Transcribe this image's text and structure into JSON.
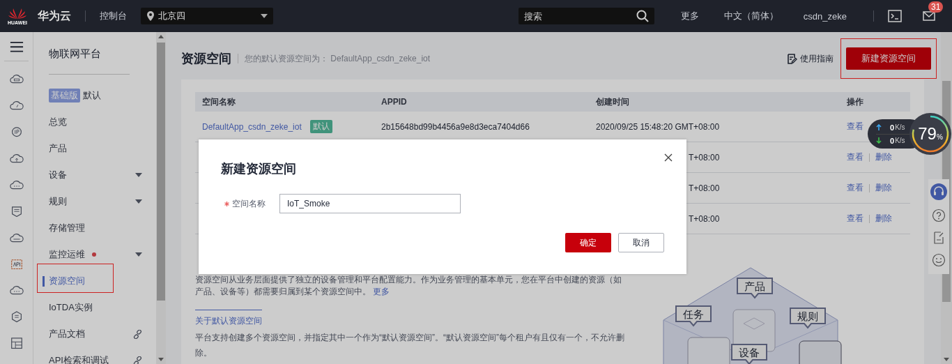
{
  "top_bar": {
    "logo_text": "HUAWEI",
    "brand": "华为云",
    "console": "控制台",
    "region": "北京四",
    "search": {
      "placeholder": "搜索"
    },
    "links": [
      "更多",
      "中文（简体）",
      "csdn_zeke"
    ],
    "mail_badge": "31"
  },
  "sidebar": {
    "title": "物联网平台",
    "items": [
      {
        "kind": "tag",
        "tag": "基础版",
        "label": "默认",
        "selected": false,
        "alert": false,
        "highlighted": false
      },
      {
        "kind": "plain",
        "label": "总览",
        "selected": false,
        "alert": false,
        "highlighted": false
      },
      {
        "kind": "plain",
        "label": "产品",
        "selected": false,
        "alert": false,
        "highlighted": false
      },
      {
        "kind": "expand",
        "label": "设备",
        "selected": false,
        "alert": false,
        "highlighted": false
      },
      {
        "kind": "expand",
        "label": "规则",
        "selected": false,
        "alert": false,
        "highlighted": false
      },
      {
        "kind": "plain",
        "label": "存储管理",
        "selected": false,
        "alert": false,
        "highlighted": false
      },
      {
        "kind": "expand",
        "label": "监控运维",
        "selected": false,
        "alert": true,
        "highlighted": false
      },
      {
        "kind": "plain",
        "label": "资源空间",
        "selected": true,
        "alert": false,
        "highlighted": true
      },
      {
        "kind": "plain",
        "label": "IoTDA实例",
        "selected": false,
        "alert": false,
        "highlighted": false
      },
      {
        "kind": "link",
        "label": "产品文档",
        "selected": false,
        "alert": false,
        "highlighted": false
      },
      {
        "kind": "link",
        "label": "API检索和调试",
        "selected": false,
        "alert": false,
        "highlighted": false
      }
    ]
  },
  "page": {
    "title": "资源空间",
    "subtitle": "您的默认资源空间为： DefaultApp_csdn_zeke_iot",
    "guide": "使用指南",
    "create_button": {
      "label": "新建资源空间",
      "highlighted": true
    }
  },
  "table": {
    "columns": [
      "空间名称",
      "APPID",
      "创建时间",
      "操作"
    ],
    "rows": [
      {
        "name": "DefaultApp_csdn_zeke_iot",
        "tag": "默认",
        "appid": "2b15648bd99b4456a9e8d3eca7404d66",
        "created": "2020/09/25 15:48:20 GMT+08:00",
        "actions": [
          "查看"
        ]
      },
      {
        "created": "T+08:00",
        "actions": [
          "查看",
          "删除"
        ]
      },
      {
        "created": "T+08:00",
        "actions": [
          "查看",
          "删除"
        ]
      },
      {
        "created": "T+08:00",
        "actions": [
          "查看",
          "删除"
        ]
      }
    ]
  },
  "intro": {
    "paragraph": "资源空间从业务层面提供了独立的设备管理和平台配置能力。作为业务管理的基本单元，您在平台中创建的资源（如产品、设备等）都需要归属到某个资源空间中。",
    "more_link": "更多",
    "about_link": "关于默认资源空间",
    "about_text": "平台支持创建多个资源空间，并指定其中一个作为“默认资源空间”。“默认资源空间”每个租户有且仅有一个，不允许删除。"
  },
  "illustration": {
    "labels": [
      "产品",
      "任务",
      "规则",
      "设备"
    ]
  },
  "dialog": {
    "title": "新建资源空间",
    "field": {
      "label": "空间名称",
      "required": true,
      "value": "IoT_Smoke"
    },
    "buttons": [
      {
        "label": "确定",
        "kind": "primary"
      },
      {
        "label": "取消",
        "kind": "secondary"
      }
    ]
  },
  "speed_widget": {
    "up": "0",
    "up_unit": "K/s",
    "down": "0",
    "down_unit": "K/s",
    "memory": "79",
    "percent": "%",
    "level": 0.79
  }
}
